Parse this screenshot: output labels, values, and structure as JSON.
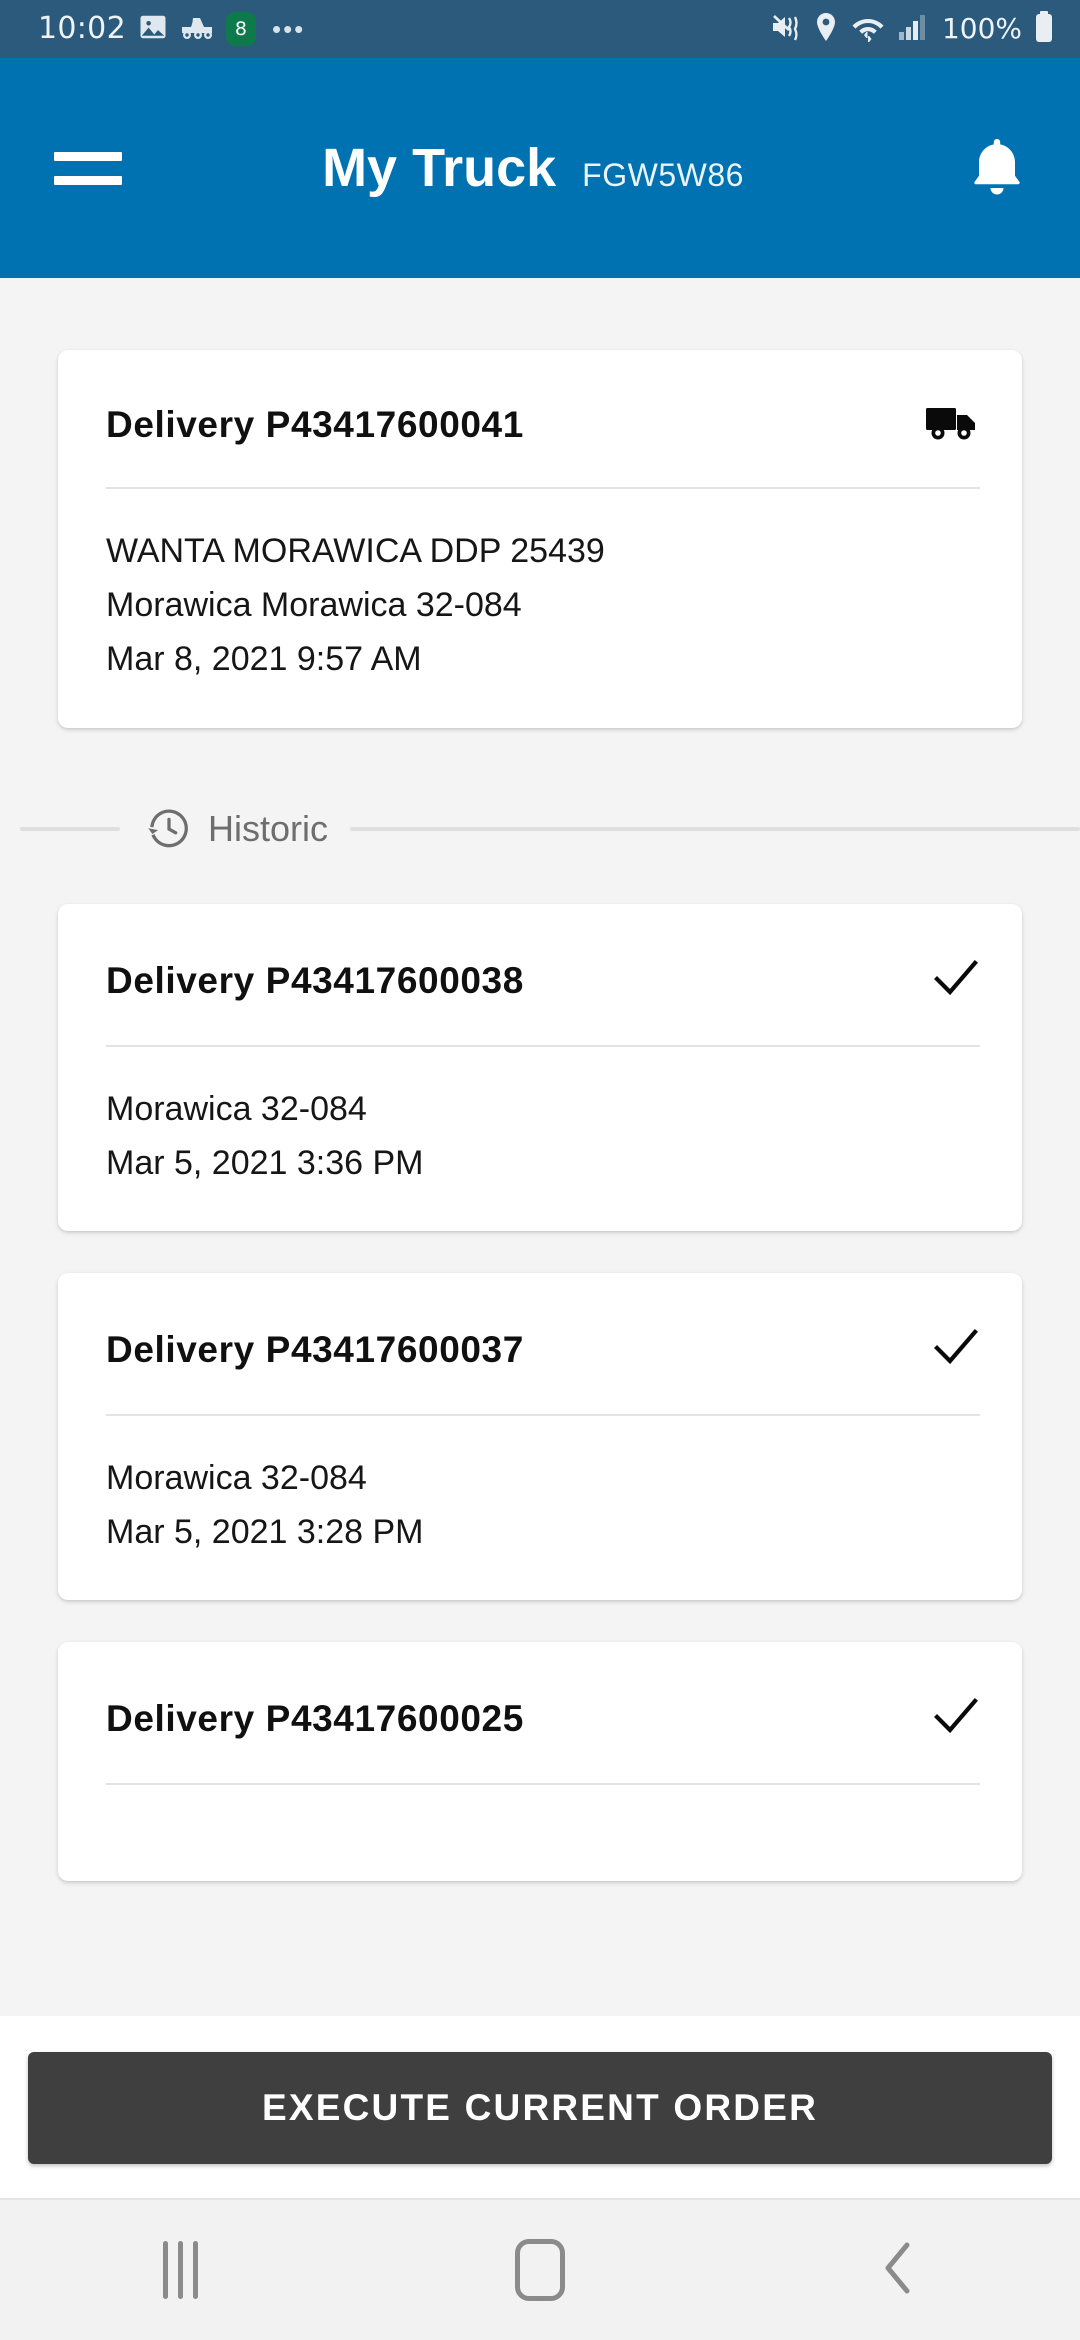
{
  "status_bar": {
    "time": "10:02",
    "battery_text": "100%",
    "badge_text": "8",
    "overflow_dots": "•••",
    "icons": [
      "image-icon",
      "cement-truck-icon",
      "calendar-badge-icon",
      "more-dots-icon",
      "mute-vibrate-icon",
      "location-icon",
      "wifi-icon",
      "cellular-signal-icon",
      "battery-icon"
    ]
  },
  "app_bar": {
    "menu_icon": "hamburger-menu-icon",
    "title": "My Truck",
    "subtitle": "FGW5W86",
    "notification_icon": "bell-icon",
    "background_color": "#0072b1"
  },
  "current_delivery": {
    "title": "Delivery P43417600041",
    "status_icon": "truck-icon",
    "customer": "WANTA MORAWICA DDP 25439",
    "address": "Morawica Morawica 32-084",
    "datetime": "Mar 8, 2021 9:57 AM"
  },
  "historic_section": {
    "label": "Historic",
    "icon": "history-clock-icon"
  },
  "historic_deliveries": [
    {
      "title": "Delivery P43417600038",
      "status_icon": "check-icon",
      "address": "Morawica 32-084",
      "datetime": "Mar 5, 2021 3:36 PM"
    },
    {
      "title": "Delivery P43417600037",
      "status_icon": "check-icon",
      "address": "Morawica 32-084",
      "datetime": "Mar 5, 2021 3:28 PM"
    },
    {
      "title": "Delivery P43417600025",
      "status_icon": "check-icon",
      "address": "",
      "datetime": ""
    }
  ],
  "bottom_action": {
    "label": "EXECUTE CURRENT ORDER",
    "color": "#3f3f3f"
  },
  "nav_bar": {
    "recents": "recents-icon",
    "home": "home-icon",
    "back": "back-icon"
  }
}
